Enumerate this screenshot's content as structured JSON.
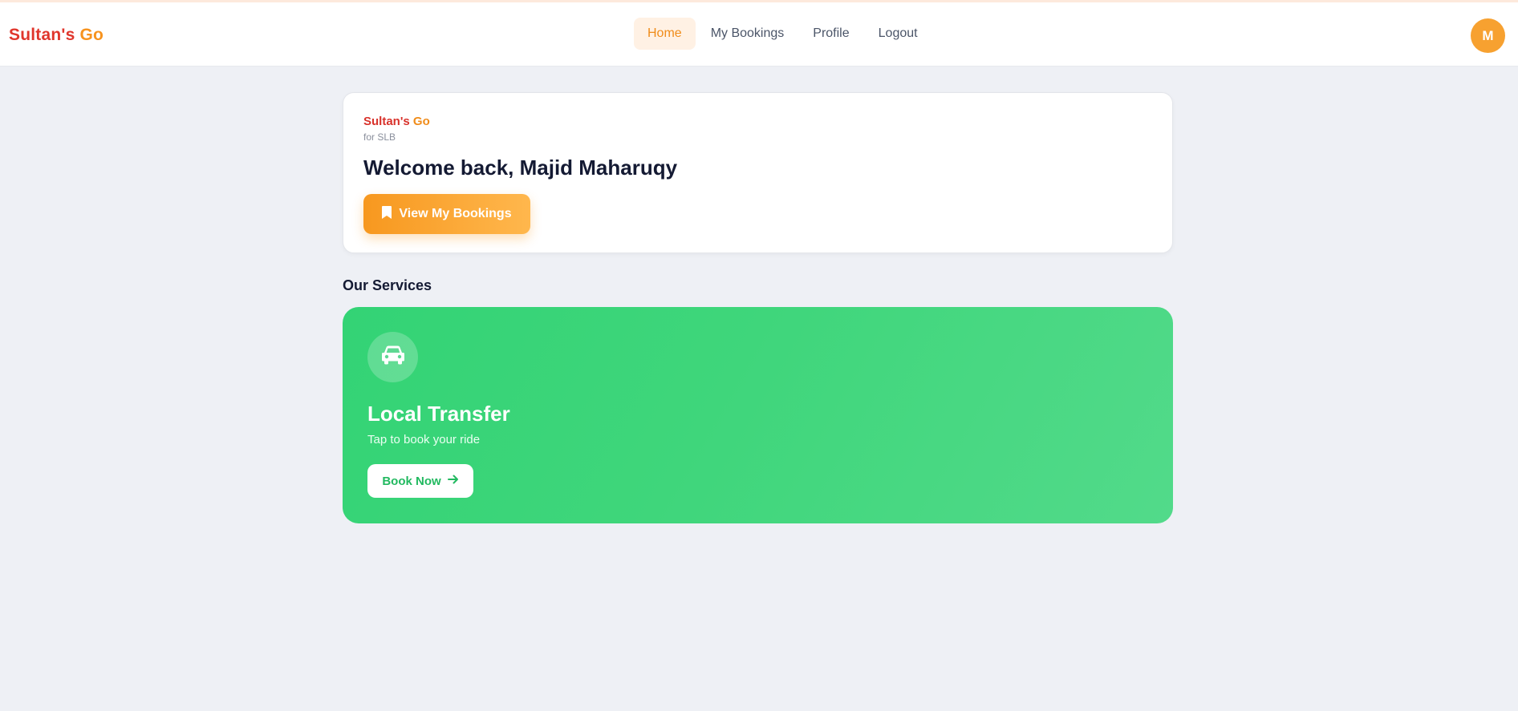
{
  "header": {
    "logo": {
      "part1": "Sultan's",
      "part2": "Go"
    },
    "nav": [
      {
        "label": "Home",
        "active": true
      },
      {
        "label": "My Bookings",
        "active": false
      },
      {
        "label": "Profile",
        "active": false
      },
      {
        "label": "Logout",
        "active": false
      }
    ],
    "avatar_initial": "M"
  },
  "welcome": {
    "brand": {
      "part1": "Sultan's",
      "part2": "Go"
    },
    "brand_sub": "for SLB",
    "title": "Welcome back, Majid Maharuqy",
    "button_label": "View My Bookings",
    "button_icon": "bookmark-icon"
  },
  "services": {
    "section_title": "Our Services",
    "items": [
      {
        "icon": "car-icon",
        "title": "Local Transfer",
        "subtitle": "Tap to book your ride",
        "button_label": "Book Now",
        "button_icon": "arrow-right-icon"
      }
    ]
  },
  "colors": {
    "brand_red": "#e0362c",
    "brand_orange": "#f7931e",
    "service_green": "#33d375",
    "page_bg": "#eef0f5"
  }
}
